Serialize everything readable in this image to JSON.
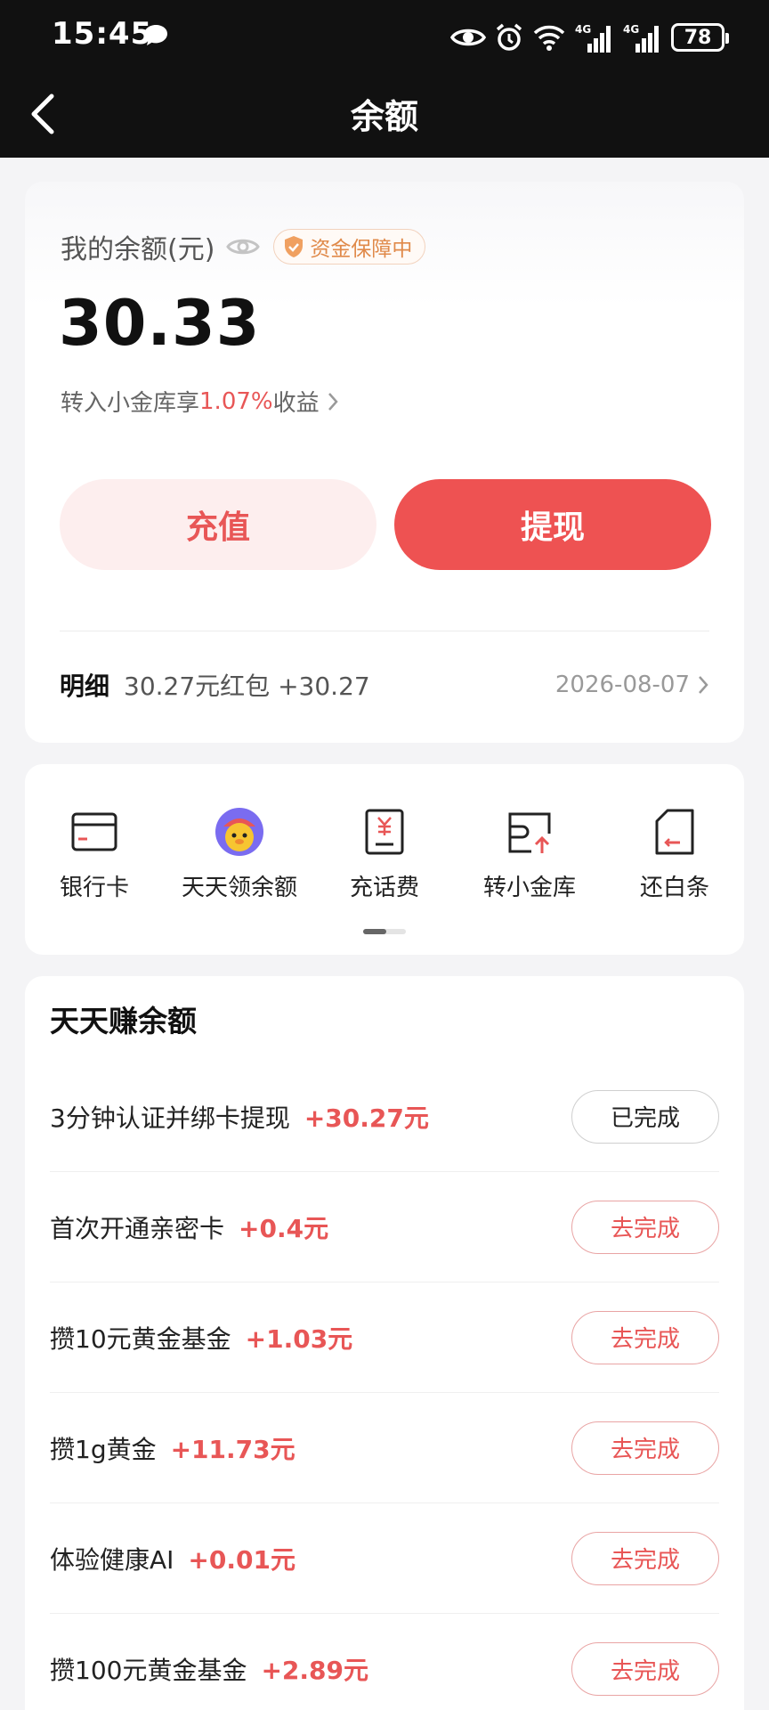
{
  "status_bar": {
    "time": "15:45",
    "battery": "78",
    "net1": "4G",
    "net2": "4G"
  },
  "header": {
    "title": "余额"
  },
  "balance": {
    "label": "我的余额(元)",
    "badge": "资金保障中",
    "amount": "30.33",
    "promo_prefix": "转入小金库享",
    "promo_rate": "1.07%",
    "promo_suffix": "收益",
    "recharge_label": "充值",
    "withdraw_label": "提现",
    "detail_label": "明细",
    "detail_text": "30.27元红包 +30.27",
    "detail_date": "2026-08-07"
  },
  "shortcuts": [
    {
      "label": "银行卡",
      "icon": "bank-card-icon"
    },
    {
      "label": "天天领余额",
      "icon": "mascot-avatar-icon"
    },
    {
      "label": "充话费",
      "icon": "phone-recharge-icon"
    },
    {
      "label": "转小金库",
      "icon": "wallet-transfer-icon"
    },
    {
      "label": "还白条",
      "icon": "repay-card-icon"
    }
  ],
  "tasks": {
    "title": "天天赚余额",
    "items": [
      {
        "name": "3分钟认证并绑卡提现",
        "reward": "+30.27元",
        "action": "已完成"
      },
      {
        "name": "首次开通亲密卡",
        "reward": "+0.4元",
        "action": "去完成"
      },
      {
        "name": "攒10元黄金基金",
        "reward": "+1.03元",
        "action": "去完成"
      },
      {
        "name": "攒1g黄金",
        "reward": "+11.73元",
        "action": "去完成"
      },
      {
        "name": "体验健康AI",
        "reward": "+0.01元",
        "action": "去完成"
      },
      {
        "name": "攒100元黄金基金",
        "reward": "+2.89元",
        "action": "去完成"
      }
    ]
  },
  "colors": {
    "accent": "#ee5252",
    "accent_light": "#fdeeee",
    "badge": "#e08a4a"
  }
}
